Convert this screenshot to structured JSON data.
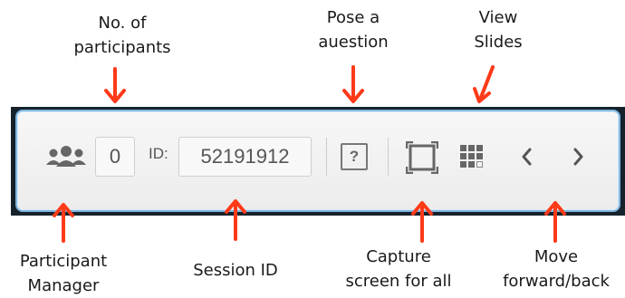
{
  "annotations": {
    "participants_count": [
      "No. of",
      "participants"
    ],
    "pose_question": [
      "Pose a",
      "auestion"
    ],
    "view_slides": [
      "View",
      "Slides"
    ],
    "participant_manager": [
      "Participant",
      "Manager"
    ],
    "session_id": "Session ID",
    "capture_screen": [
      "Capture",
      "screen for all"
    ],
    "move_forward_back": [
      "Move",
      "forward/back"
    ]
  },
  "toolbar": {
    "participant_count": "0",
    "id_label": "ID:",
    "session_id_value": "52191912",
    "question_icon_glyph": "?"
  },
  "icons": {
    "participant_manager": "users-icon",
    "question": "question-icon",
    "capture": "capture-icon",
    "slides": "grid-icon",
    "back": "chevron-left-icon",
    "forward": "chevron-right-icon"
  },
  "colors": {
    "arrow": "#ff3a18",
    "toolbar_border": "#7fb7e3",
    "icon": "#666666"
  }
}
